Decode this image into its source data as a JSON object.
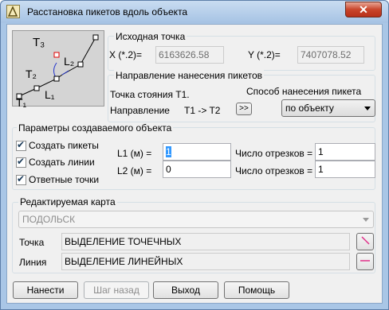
{
  "window": {
    "title": "Расстановка пикетов вдоль объекта",
    "close_label": "✕"
  },
  "diagram": {
    "labels": [
      "T₃",
      "L₂",
      "T₂",
      "L₁",
      "T₁"
    ]
  },
  "source_point": {
    "group_label": "Исходная точка",
    "x_label": "X (*.2)=",
    "x_value": "6163626.58",
    "y_label": "Y (*.2)=",
    "y_value": "7407078.52"
  },
  "direction": {
    "group_label": "Направление нанесения пикетов",
    "station_text": "Точка стояния Т1.",
    "method_label": "Способ нанесения пикета",
    "direction_label": "Направление",
    "direction_value": "T1 -> T2",
    "swap_button": ">>",
    "method_value": "по объекту"
  },
  "params": {
    "group_label": "Параметры создаваемого объекта",
    "create_pickets": "Создать пикеты",
    "create_lines": "Создать линии",
    "reply_points": "Ответные точки",
    "l1_label": "L1 (м) =",
    "l1_value": "1",
    "l2_label": "L2 (м) =",
    "l2_value": "0",
    "seg1_label": "Число отрезков =",
    "seg1_value": "1",
    "seg2_label": "Число отрезков =",
    "seg2_value": "1"
  },
  "map": {
    "group_label": "Редактируемая карта",
    "map_value": "ПОДОЛЬСК",
    "point_label": "Точка",
    "point_value": "ВЫДЕЛЕНИЕ ТОЧЕЧНЫХ",
    "line_label": "Линия",
    "line_value": "ВЫДЕЛЕНИЕ ЛИНЕЙНЫХ"
  },
  "buttons": {
    "apply": "Нанести",
    "step_back": "Шаг назад",
    "exit": "Выход",
    "help": "Помощь"
  }
}
